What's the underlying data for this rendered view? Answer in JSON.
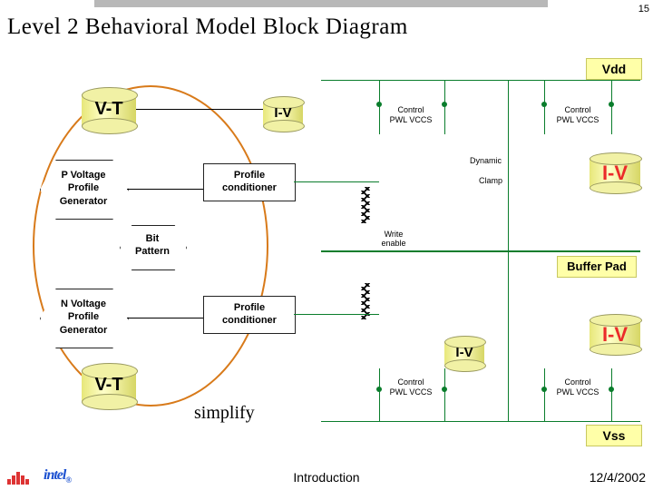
{
  "page": {
    "number": "15",
    "title": "Level 2 Behavioral Model Block Diagram"
  },
  "rails": {
    "vdd": "Vdd",
    "vss": "Vss",
    "buffer_pad": "Buffer Pad"
  },
  "cyl": {
    "vt_top": "V-T",
    "vt_bot": "V-T",
    "iv_top": "I-V",
    "iv_mid": "I-V",
    "iv_right_top": "I-V",
    "iv_right_bot": "I-V"
  },
  "hex": {
    "p_gen": "P Voltage\nProfile\nGenerator",
    "n_gen": "N Voltage\nProfile\nGenerator",
    "bit_pattern": "Bit\nPattern"
  },
  "box": {
    "profile_conditioner": "Profile\nconditioner"
  },
  "ctrl": {
    "control": "Control",
    "pwl_vccs": "PWL VCCS",
    "dynamic": "Dynamic",
    "clamp": "Clamp",
    "write_enable": "Write\nenable"
  },
  "annot": {
    "simplify": "simplify"
  },
  "footer": {
    "section": "Introduction",
    "date": "12/4/2002",
    "brand": "intel"
  }
}
